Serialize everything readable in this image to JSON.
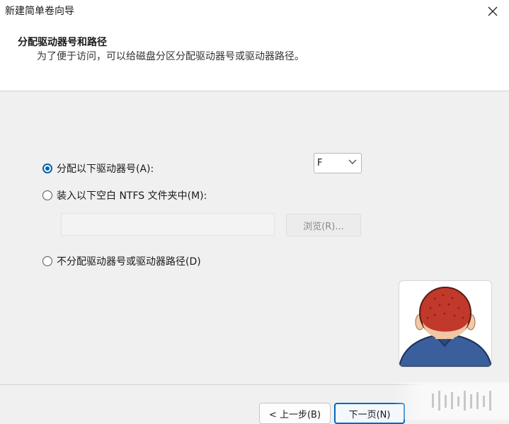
{
  "window": {
    "title": "新建简单卷向导"
  },
  "header": {
    "title": "分配驱动器号和路径",
    "subtitle": "为了便于访问，可以给磁盘分区分配驱动器号或驱动器路径。"
  },
  "options": [
    {
      "label": "分配以下驱动器号(A):",
      "checked": true
    },
    {
      "label": "装入以下空白 NTFS 文件夹中(M):",
      "checked": false
    },
    {
      "label": "不分配驱动器号或驱动器路径(D)",
      "checked": false
    }
  ],
  "drive_letter": {
    "value": "F"
  },
  "folder_path": {
    "value": ""
  },
  "browse_button": {
    "label": "浏览(R)..."
  },
  "footer": {
    "back_label": "< 上一步(B)",
    "next_label": "下一页(N)"
  },
  "icons": {
    "close": "close-icon",
    "dropdown": "chevron-down-icon",
    "avatar": "user-avatar-icon"
  },
  "colors": {
    "accent": "#0063b1"
  }
}
